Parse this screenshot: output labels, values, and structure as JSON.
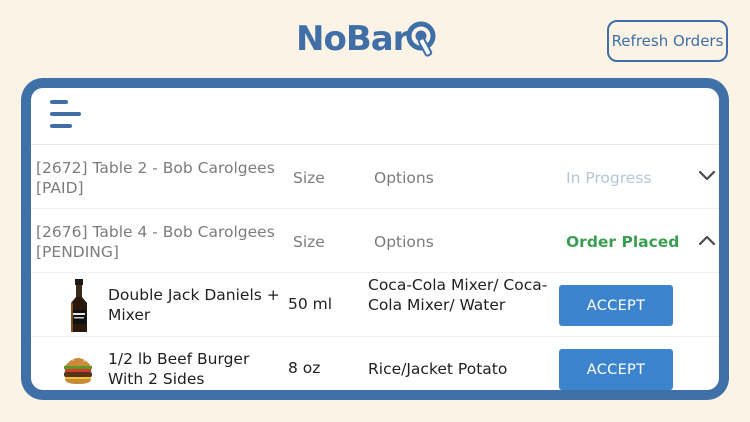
{
  "app": {
    "logo_text": "NoBarQ",
    "logo_main": "NoBar",
    "logo_end": "Q"
  },
  "header": {
    "refresh_label": "Refresh Orders"
  },
  "colors": {
    "brand": "#3f6fa6",
    "accept": "#3d84cf",
    "placed": "#3a9e52",
    "in_progress": "#b5c6d8",
    "background": "#fbf3e6"
  },
  "orders": [
    {
      "title": "[2672] Table 2 - Bob Carolgees [PAID]",
      "size_header": "Size",
      "options_header": "Options",
      "status": "In Progress",
      "expanded": false
    },
    {
      "title": "[2676] Table 4 - Bob Carolgees [PENDING]",
      "size_header": "Size",
      "options_header": "Options",
      "status": "Order Placed",
      "expanded": true
    }
  ],
  "items": [
    {
      "name": "Double Jack Daniels + Mixer",
      "size": "50 ml",
      "options": "Coca-Cola Mixer/ Coca-Cola Mixer/ Water",
      "action": "ACCEPT",
      "icon": "whiskey-bottle-icon"
    },
    {
      "name": "1/2 lb Beef Burger With 2 Sides",
      "size": "8 oz",
      "options": "Rice/Jacket Potato",
      "action": "ACCEPT",
      "icon": "burger-icon"
    }
  ]
}
